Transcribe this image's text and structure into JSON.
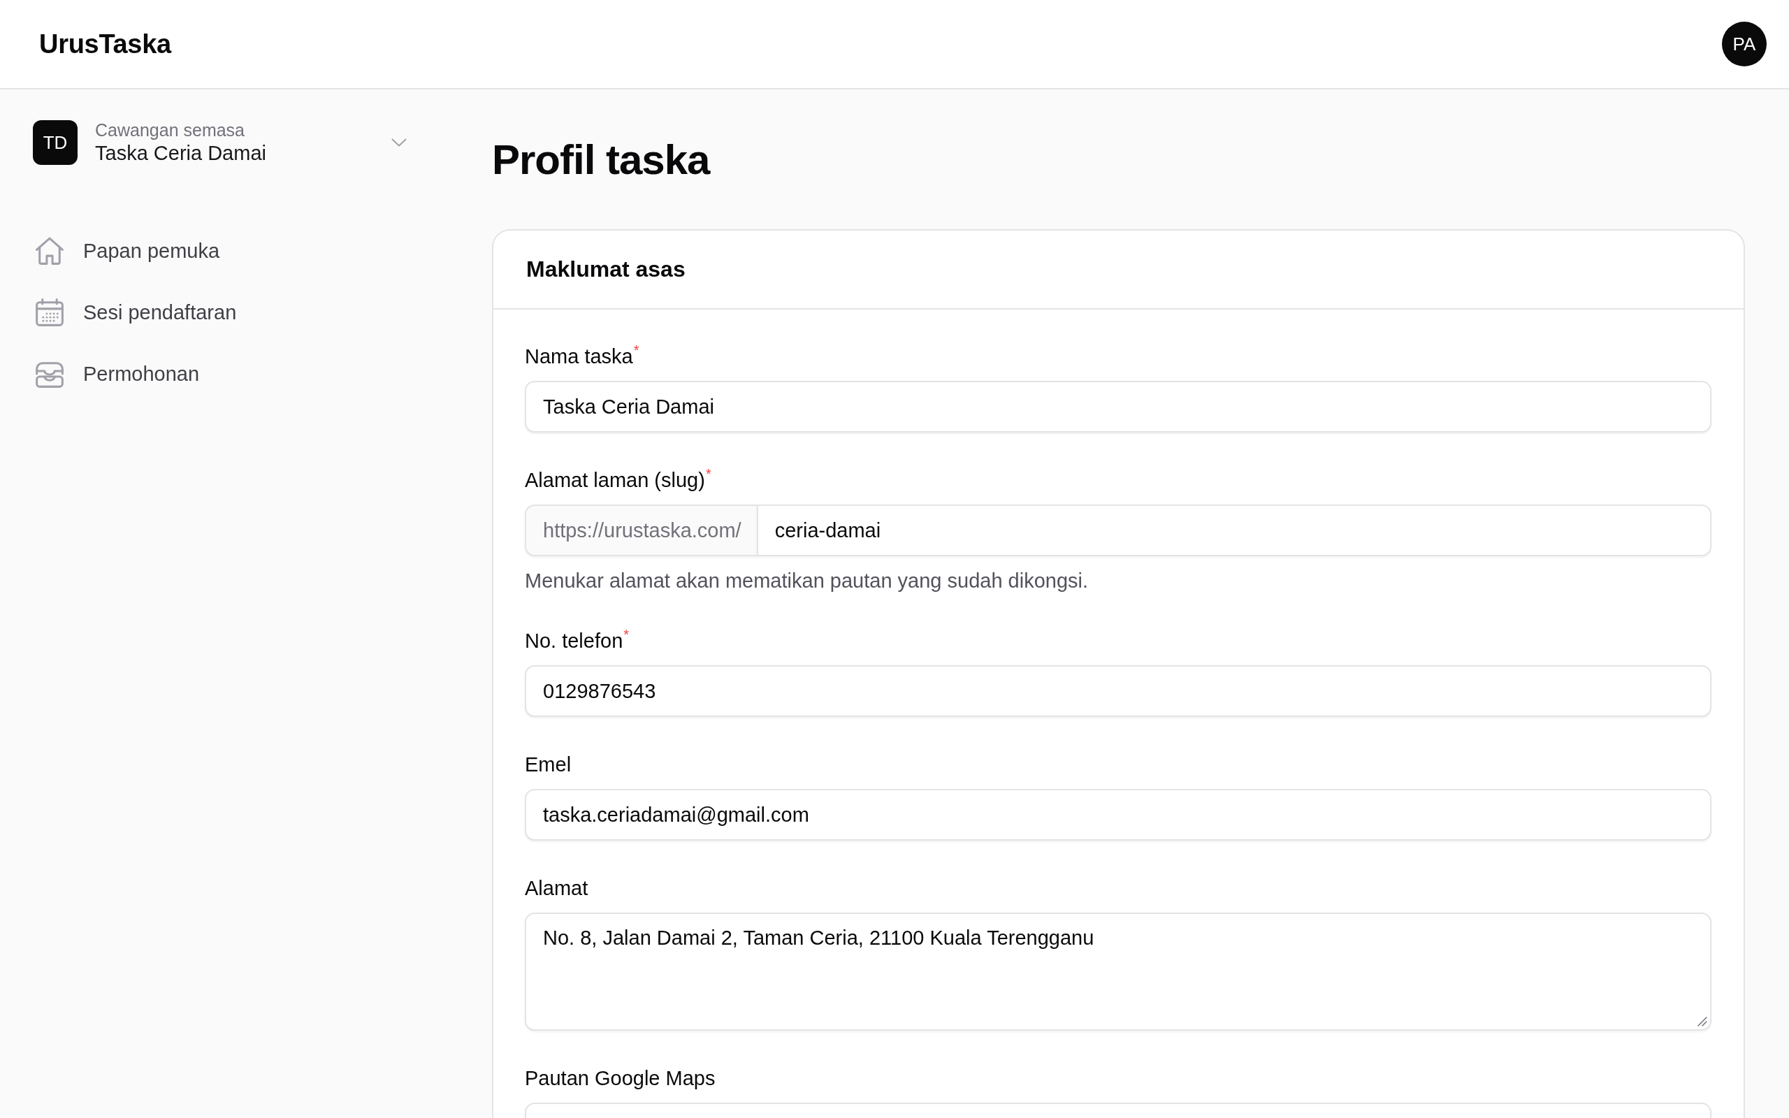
{
  "header": {
    "logo": "UrusTaska",
    "avatar_initials": "PA"
  },
  "sidebar": {
    "branch_switcher": {
      "initials": "TD",
      "caption": "Cawangan semasa",
      "name": "Taska Ceria Damai"
    },
    "items": [
      {
        "label": "Papan pemuka",
        "selected": false
      },
      {
        "label": "Sesi pendaftaran",
        "selected": false
      },
      {
        "label": "Permohonan",
        "selected": false
      }
    ]
  },
  "page_title": "Profil taska",
  "card": {
    "title": "Maklumat asas",
    "fields": [
      {
        "kind": "text",
        "label": "Nama taska$^{*}$",
        "value": "Taska Ceria Damai"
      },
      {
        "kind": "prefixed",
        "label": "Alamat laman (slug)$^{*}$",
        "prefix": "https://urustaska.com/",
        "value": "ceria-damai",
        "hint": "Menukar alamat akan mematikan pautan yang sudah dikongsi."
      },
      {
        "kind": "text",
        "label": "No. telefon$^{*}$",
        "value": "0129876543"
      },
      {
        "kind": "text",
        "label": "Emel",
        "value": "taska.ceriadamai@gmail.com"
      },
      {
        "kind": "textarea",
        "label": "Alamat",
        "value": "No. 8, Jalan Damai 2, Taman Ceria, 21100 Kuala Terengganu"
      },
      {
        "kind": "text",
        "label": "Pautan Google Maps"
      }
    ]
  }
}
